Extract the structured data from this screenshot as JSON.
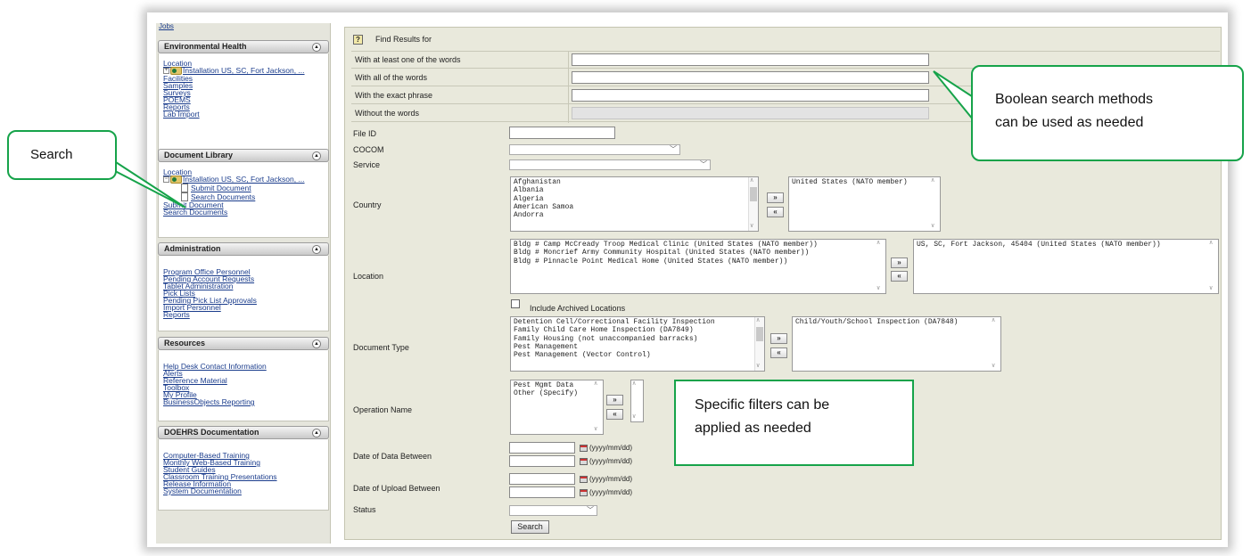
{
  "sidebar": {
    "top_partial_link": "Jobs",
    "environmental_health": {
      "title": "Environmental Health",
      "items": [
        "Location",
        "Facilities",
        "Samples",
        "Surveys",
        "POEMS",
        "Reports",
        "Lab Import"
      ],
      "tree_label": "Installation US, SC, Fort Jackson, ..."
    },
    "document_library": {
      "title": "Document Library",
      "location_label": "Location",
      "tree_label": "Installation US, SC, Fort Jackson, ...",
      "tree_children": [
        "Submit Document",
        "Search Documents"
      ],
      "items": [
        "Submit Document",
        "Search Documents"
      ]
    },
    "administration": {
      "title": "Administration",
      "items": [
        "Program Office Personnel",
        "Pending Account Requests",
        "Tablet Administration",
        "Pick Lists",
        "Pending Pick List Approvals",
        "Import Personnel",
        "Reports"
      ]
    },
    "resources": {
      "title": "Resources",
      "items": [
        "Help Desk Contact Information",
        "Alerts",
        "Reference Material",
        "Toolbox",
        "My Profile",
        "BusinessObjects Reporting"
      ]
    },
    "doehrs_documentation": {
      "title": "DOEHRS Documentation",
      "items": [
        "Computer-Based Training",
        "Monthly Web-Based Training",
        "Student Guides",
        "Classroom Training Presentations",
        "Release Information",
        "System Documentation"
      ]
    }
  },
  "form": {
    "find_results_label": "Find Results for",
    "boolean": {
      "at_least_one": "With at least one of the words",
      "all_words": "With all of the words",
      "exact_phrase": "With the exact phrase",
      "without_words": "Without the words"
    },
    "file_id_label": "File ID",
    "cocom_label": "COCOM",
    "service_label": "Service",
    "country": {
      "label": "Country",
      "available": [
        "Afghanistan",
        "Albania",
        "Algeria",
        "American Samoa",
        "Andorra"
      ],
      "selected": [
        "United States (NATO member)"
      ]
    },
    "location": {
      "label": "Location",
      "available": [
        "Bldg # Camp McCready Troop Medical Clinic (United States (NATO member))",
        "Bldg # Moncrief Army Community Hospital (United States (NATO member))",
        "Bldg # Pinnacle Point Medical Home (United States (NATO member))"
      ],
      "selected": [
        "US, SC, Fort Jackson, 45404 (United States (NATO member))"
      ],
      "include_archived": "Include Archived Locations"
    },
    "document_type": {
      "label": "Document Type",
      "available": [
        "Detention Cell/Correctional Facility Inspection",
        "Family Child Care Home Inspection (DA7849)",
        "Family Housing (not unaccompanied barracks)",
        "Pest Management",
        "Pest Management (Vector Control)"
      ],
      "selected": [
        "Child/Youth/School Inspection (DA7848)"
      ]
    },
    "operation_name": {
      "label": "Operation Name",
      "available": [
        "Pest Mgmt Data",
        "Other (Specify)"
      ]
    },
    "date_of_data_label": "Date of Data Between",
    "date_of_upload_label": "Date of Upload Between",
    "date_format": "(yyyy/mm/dd)",
    "status_label": "Status",
    "search_button": "Search",
    "move_right": "»",
    "move_left": "«",
    "help_icon": "?"
  },
  "callouts": {
    "search": "Search",
    "boolean_line1": "Boolean search methods",
    "boolean_line2": "can be used as needed",
    "filters_line1": "Specific filters can be",
    "filters_line2": "applied as needed"
  },
  "colors": {
    "callout_border": "#16a34a",
    "panel_bg": "#e9e9dc",
    "link": "#1a3c8c"
  }
}
